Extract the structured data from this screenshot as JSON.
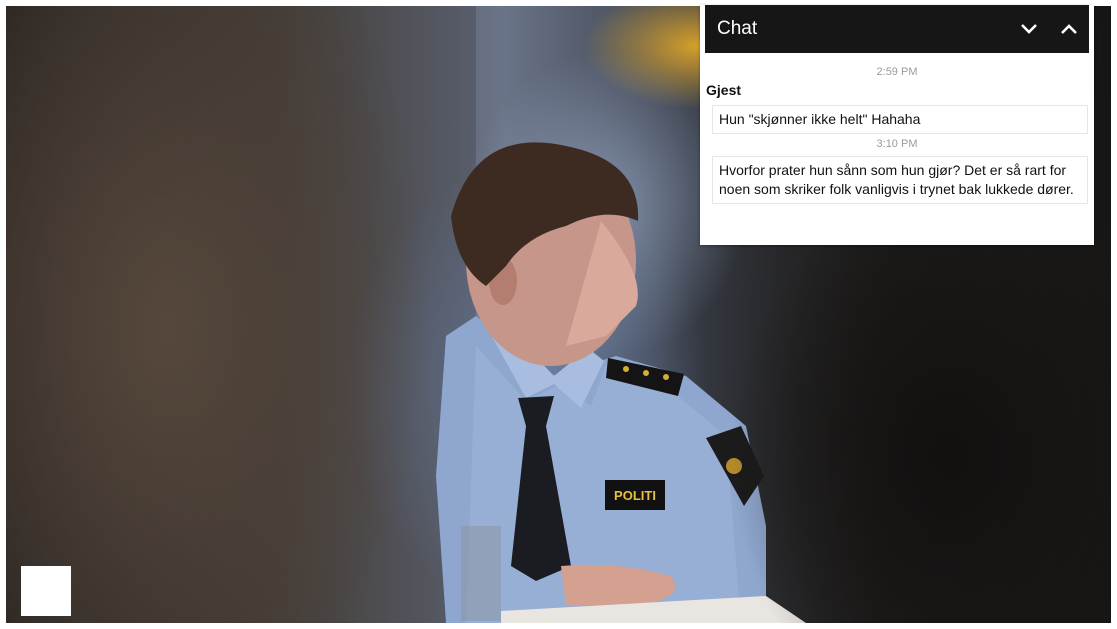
{
  "chat": {
    "title": "Chat",
    "collapse_icon": "chevron-down-icon",
    "expand_icon": "chevron-up-icon",
    "messages": [
      {
        "time": "2:59 PM",
        "author": "Gjest",
        "text": "Hun \"skjønner ikke helt\" Hahaha"
      },
      {
        "time": "3:10 PM",
        "text": "Hvorfor prater hun sånn som hun gjør? Det er så rart for noen som skriker folk vanligvis i trynet bak lukkede dører."
      }
    ]
  },
  "photo": {
    "badge_text": "POLITI"
  },
  "colors": {
    "chat_header_bg": "#161616",
    "chat_bg": "#ffffff",
    "timestamp": "#9a9a9a",
    "uniform": "#8fa7cf",
    "badge_bg": "#111111",
    "badge_text": "#e8c23a"
  }
}
